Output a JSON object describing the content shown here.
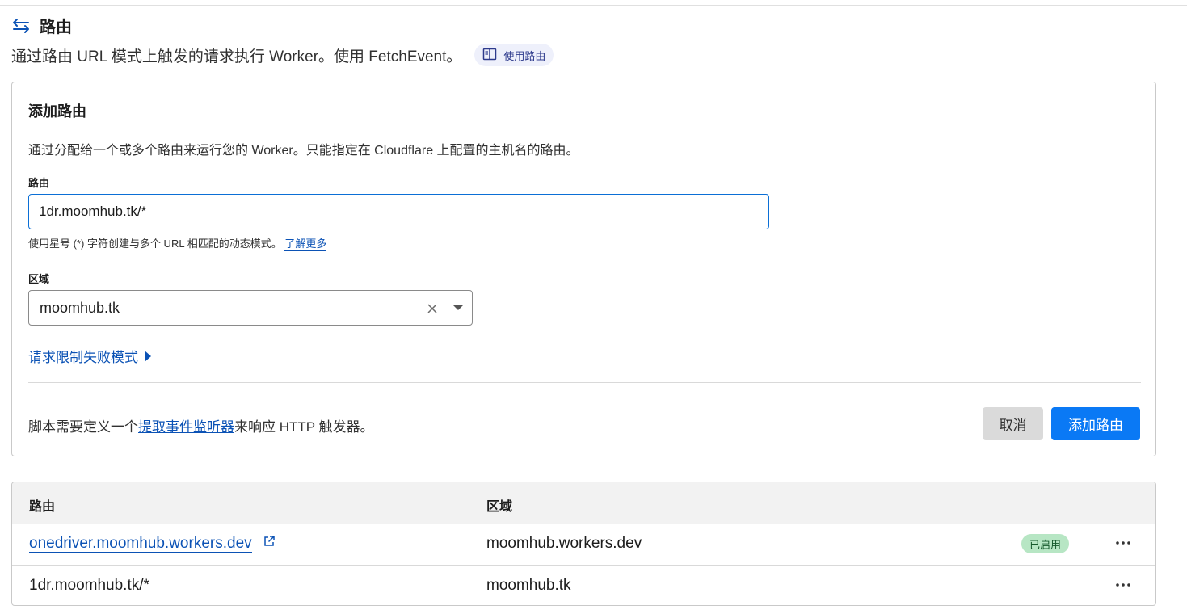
{
  "section": {
    "icon": "arrows-swap-icon",
    "title": "路由",
    "description": "通过路由 URL 模式上触发的请求执行 Worker。使用 FetchEvent。",
    "doc_pill": {
      "icon": "book-icon",
      "label": "使用路由"
    }
  },
  "add_route_card": {
    "title": "添加路由",
    "description": "通过分配给一个或多个路由来运行您的 Worker。只能指定在 Cloudflare 上配置的主机名的路由。",
    "route_label": "路由",
    "route_value": "1dr.moomhub.tk/*",
    "helper_text": "使用星号 (*) 字符创建与多个 URL 相匹配的动态模式。",
    "helper_link": "了解更多",
    "zone_label": "区域",
    "zone_value": "moomhub.tk",
    "rate_limit_toggle": "请求限制失败模式",
    "footer_prefix": "脚本需要定义一个",
    "footer_link": "提取事件监听器",
    "footer_suffix": "来响应 HTTP 触发器。",
    "cancel_label": "取消",
    "add_label": "添加路由"
  },
  "routes_table": {
    "columns": [
      "路由",
      "区域"
    ],
    "rows": [
      {
        "route": "onedriver.moomhub.workers.dev",
        "zone": "moomhub.workers.dev",
        "status": "已启用",
        "is_link": true
      },
      {
        "route": "1dr.moomhub.tk/*",
        "zone": "moomhub.tk",
        "status": "",
        "is_link": false
      }
    ]
  },
  "colors": {
    "accent": "#0a79f5",
    "link": "#0b52b5",
    "badge_bg": "#b7e6c4",
    "badge_text": "#16592c"
  }
}
